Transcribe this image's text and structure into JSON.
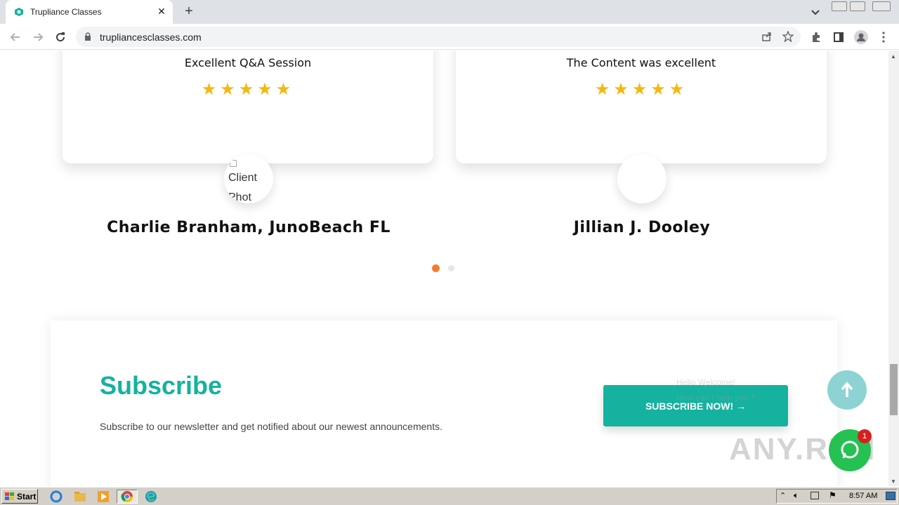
{
  "browser": {
    "tab_title": "Trupliance Classes",
    "url": "trupliancesclasses.com"
  },
  "testimonials": [
    {
      "headline": "Excellent Q&A Session",
      "stars": "★★★★★",
      "avatar_alt": "Client Phot",
      "name": "Charlie Branham, JunoBeach FL"
    },
    {
      "headline": "The Content was excellent",
      "stars": "★★★★★",
      "avatar_alt": "",
      "name": "Jillian J. Dooley"
    }
  ],
  "carousel": {
    "active_dot_color": "#f47b30",
    "inactive_dot_color": "#e6e6e6"
  },
  "subscribe": {
    "heading": "Subscribe",
    "description": "Subscribe to our newsletter and get notified about our newest announcements.",
    "button_label": "SUBSCRIBE NOW! →",
    "ghost_line1": "Hello Welcome!",
    "ghost_line2": "How can I help you ?"
  },
  "widgets": {
    "badge_count": "1",
    "watermark": "ANY.RUN"
  },
  "taskbar": {
    "start_label": "Start",
    "clock": "8:57 AM"
  },
  "colors": {
    "accent": "#14b29f",
    "star": "#f5b80b",
    "whatsapp": "#25c153"
  }
}
